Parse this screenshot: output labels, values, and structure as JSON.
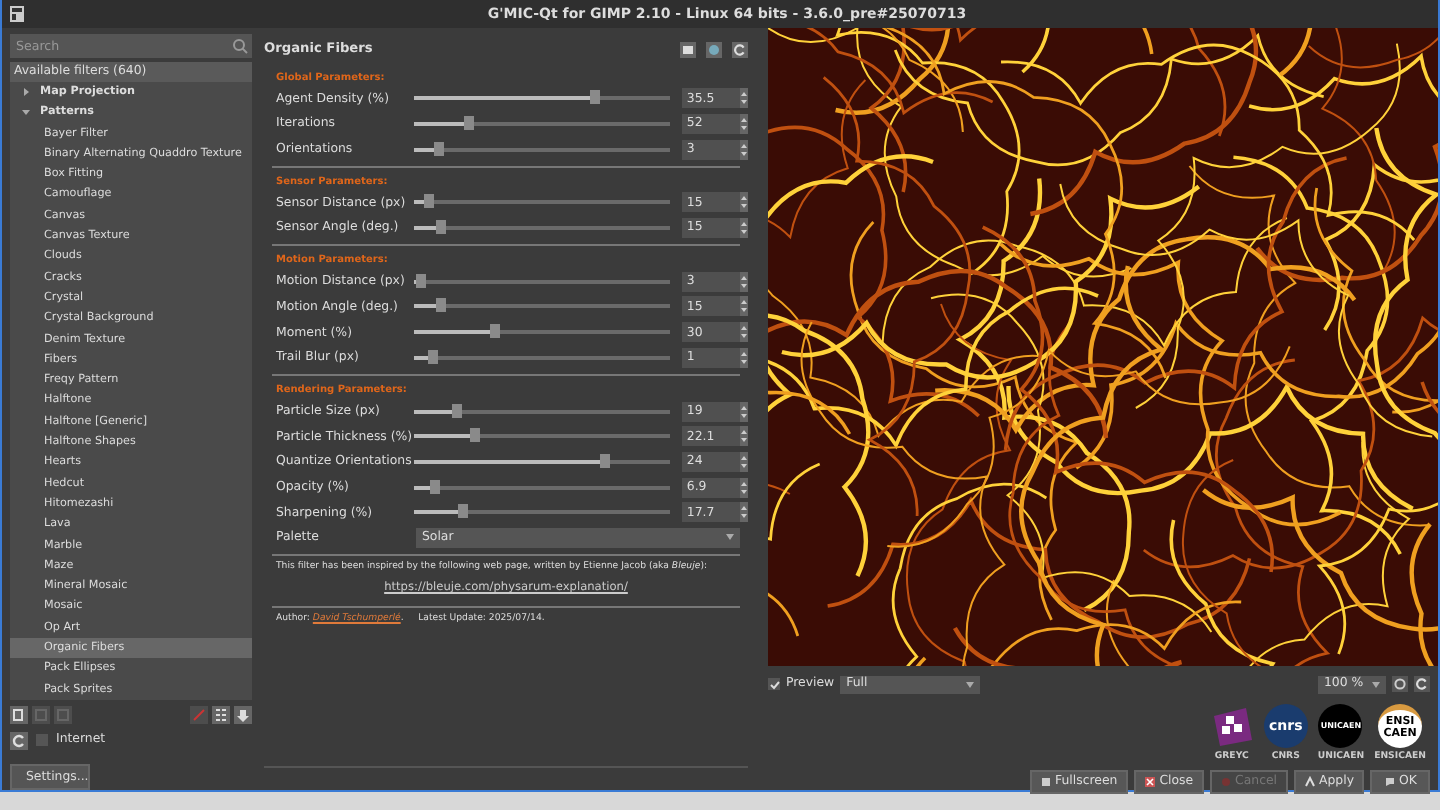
{
  "window": {
    "title": "G'MIC-Qt for GIMP 2.10 - Linux 64 bits - 3.6.0_pre#25070713"
  },
  "filter_panel": {
    "search": {
      "placeholder": "Search"
    },
    "header": "Available filters (640)",
    "tree": [
      {
        "label": "Map Projection",
        "expanded": false
      },
      {
        "label": "Patterns",
        "expanded": true,
        "children": [
          {
            "label": "Bayer Filter",
            "selected": false
          },
          {
            "label": "Binary Alternating Quaddro Texture",
            "selected": false
          },
          {
            "label": "Box Fitting",
            "selected": false
          },
          {
            "label": "Camouflage",
            "selected": false
          },
          {
            "label": "Canvas",
            "selected": false
          },
          {
            "label": "Canvas Texture",
            "selected": false
          },
          {
            "label": "Clouds",
            "selected": false
          },
          {
            "label": "Cracks",
            "selected": false
          },
          {
            "label": "Crystal",
            "selected": false
          },
          {
            "label": "Crystal Background",
            "selected": false
          },
          {
            "label": "Denim Texture",
            "selected": false
          },
          {
            "label": "Fibers",
            "selected": false
          },
          {
            "label": "Freqy Pattern",
            "selected": false
          },
          {
            "label": "Halftone",
            "selected": false
          },
          {
            "label": "Halftone [Generic]",
            "selected": false
          },
          {
            "label": "Halftone Shapes",
            "selected": false
          },
          {
            "label": "Hearts",
            "selected": false
          },
          {
            "label": "Hedcut",
            "selected": false
          },
          {
            "label": "Hitomezashi",
            "selected": false
          },
          {
            "label": "Lava",
            "selected": false
          },
          {
            "label": "Marble",
            "selected": false
          },
          {
            "label": "Maze",
            "selected": false
          },
          {
            "label": "Mineral Mosaic",
            "selected": false
          },
          {
            "label": "Mosaic",
            "selected": false
          },
          {
            "label": "Op Art",
            "selected": false
          },
          {
            "label": "Organic Fibers",
            "selected": true
          },
          {
            "label": "Pack Ellipses",
            "selected": false
          },
          {
            "label": "Pack Sprites",
            "selected": false
          }
        ]
      }
    ],
    "internet": {
      "label": "Internet",
      "checked": false
    },
    "settings_button": "Settings..."
  },
  "filter": {
    "title": "Organic Fibers",
    "sections": [
      {
        "title": "Global Parameters:",
        "params": [
          {
            "kind": "slider",
            "label": "Agent Density (%)",
            "level": 0.7,
            "value": "35.5"
          },
          {
            "kind": "slider",
            "label": "Iterations",
            "level": 0.21,
            "value": "52"
          },
          {
            "kind": "slider",
            "label": "Orientations",
            "level": 0.09,
            "value": "3"
          }
        ]
      },
      {
        "title": "Sensor Parameters:",
        "params": [
          {
            "kind": "slider",
            "label": "Sensor Distance (px)",
            "level": 0.05,
            "value": "15"
          },
          {
            "kind": "slider",
            "label": "Sensor Angle (deg.)",
            "level": 0.1,
            "value": "15"
          }
        ]
      },
      {
        "title": "Motion Parameters:",
        "params": [
          {
            "kind": "slider",
            "label": "Motion Distance (px)",
            "level": 0.02,
            "value": "3"
          },
          {
            "kind": "slider",
            "label": "Motion Angle (deg.)",
            "level": 0.1,
            "value": "15"
          },
          {
            "kind": "slider",
            "label": "Moment (%)",
            "level": 0.31,
            "value": "30"
          },
          {
            "kind": "slider",
            "label": "Trail Blur (px)",
            "level": 0.07,
            "value": "1"
          }
        ]
      },
      {
        "title": "Rendering Parameters:",
        "params": [
          {
            "kind": "slider",
            "label": "Particle Size (px)",
            "level": 0.16,
            "value": "19"
          },
          {
            "kind": "slider",
            "label": "Particle Thickness (%)",
            "level": 0.23,
            "value": "22.1"
          },
          {
            "kind": "slider",
            "label": "Quantize Orientations",
            "level": 0.74,
            "value": "24"
          },
          {
            "kind": "slider",
            "label": "Opacity (%)",
            "level": 0.08,
            "value": "6.9"
          },
          {
            "kind": "slider",
            "label": "Sharpening (%)",
            "level": 0.19,
            "value": "17.7"
          },
          {
            "kind": "select",
            "label": "Palette",
            "value": "Solar"
          }
        ]
      }
    ],
    "note": "This filter has been inspired by the following web page, written by Etienne Jacob (aka *Bleuje*):",
    "link": "https://bleuje.com/physarum-explanation/",
    "author": {
      "prefix": "Author:",
      "name": "David Tschumperlé",
      "suffix": ".",
      "update": "Latest Update: 2025/07/14."
    }
  },
  "preview": {
    "label": "Preview",
    "checked": true,
    "mode": "Full",
    "zoom": "100 %"
  },
  "logos": [
    {
      "kind": "greyc",
      "caption": "GREYC"
    },
    {
      "kind": "cnrs",
      "mark": "cnrs",
      "caption": "CNRS"
    },
    {
      "kind": "unicaen",
      "mark": "UNICAEN",
      "caption": "UNICAEN"
    },
    {
      "kind": "ensicaen",
      "mark": "ENSI CAEN",
      "caption": "ENSICAEN"
    }
  ],
  "buttons": [
    {
      "kind": "fullscreen",
      "label": "Fullscreen",
      "disabled": false
    },
    {
      "kind": "close",
      "label": "Close",
      "disabled": false
    },
    {
      "kind": "cancel",
      "label": "Cancel",
      "disabled": true
    },
    {
      "kind": "apply",
      "label": "Apply",
      "disabled": false
    },
    {
      "kind": "ok",
      "label": "OK",
      "disabled": false
    }
  ]
}
